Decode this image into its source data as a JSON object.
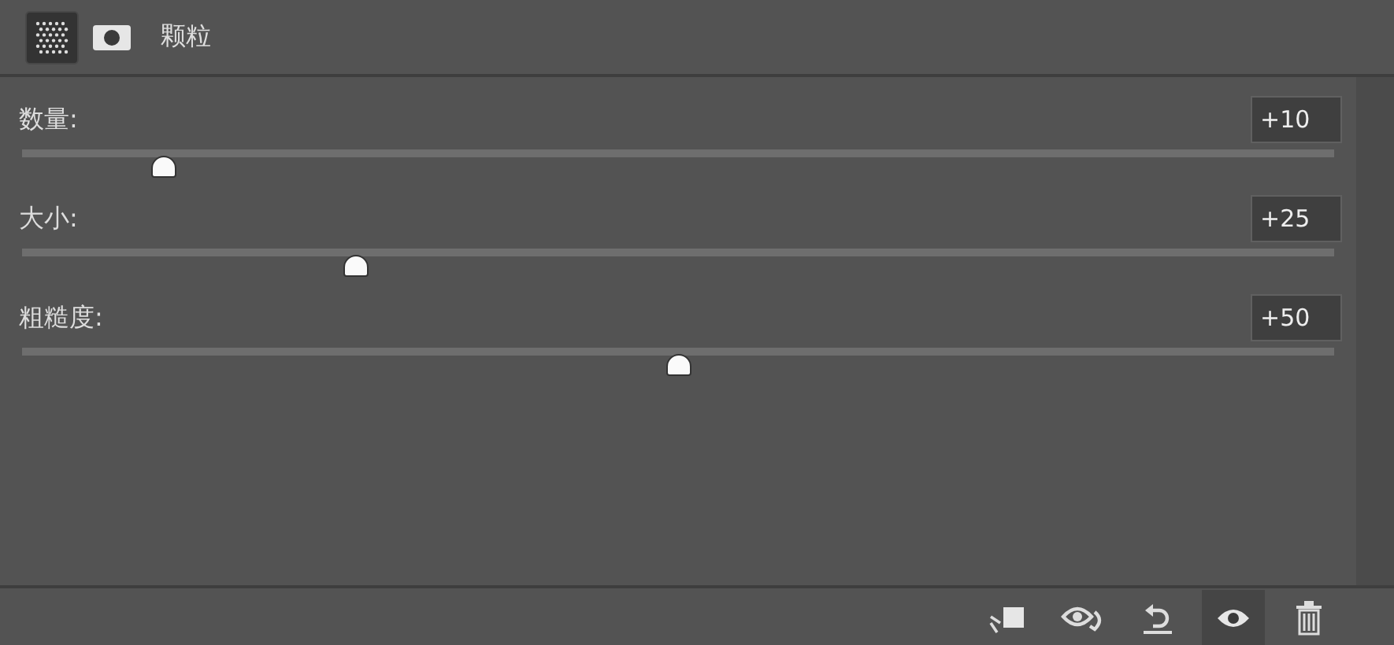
{
  "header": {
    "tabs": [
      {
        "kind": "grain",
        "selected": true
      },
      {
        "kind": "mask",
        "selected": false
      }
    ],
    "title": "颗粒"
  },
  "sliders": [
    {
      "label": "数量:",
      "value": "+10",
      "level": 0.1
    },
    {
      "label": "大小:",
      "value": "+25",
      "level": 0.25
    },
    {
      "label": "粗糙度:",
      "value": "+50",
      "level": 0.5
    }
  ],
  "toolbar": [
    {
      "kind": "clip",
      "selected": false
    },
    {
      "kind": "view-previous",
      "selected": false
    },
    {
      "kind": "reset",
      "selected": false
    },
    {
      "kind": "visibility",
      "selected": true
    },
    {
      "kind": "delete",
      "selected": false
    }
  ]
}
